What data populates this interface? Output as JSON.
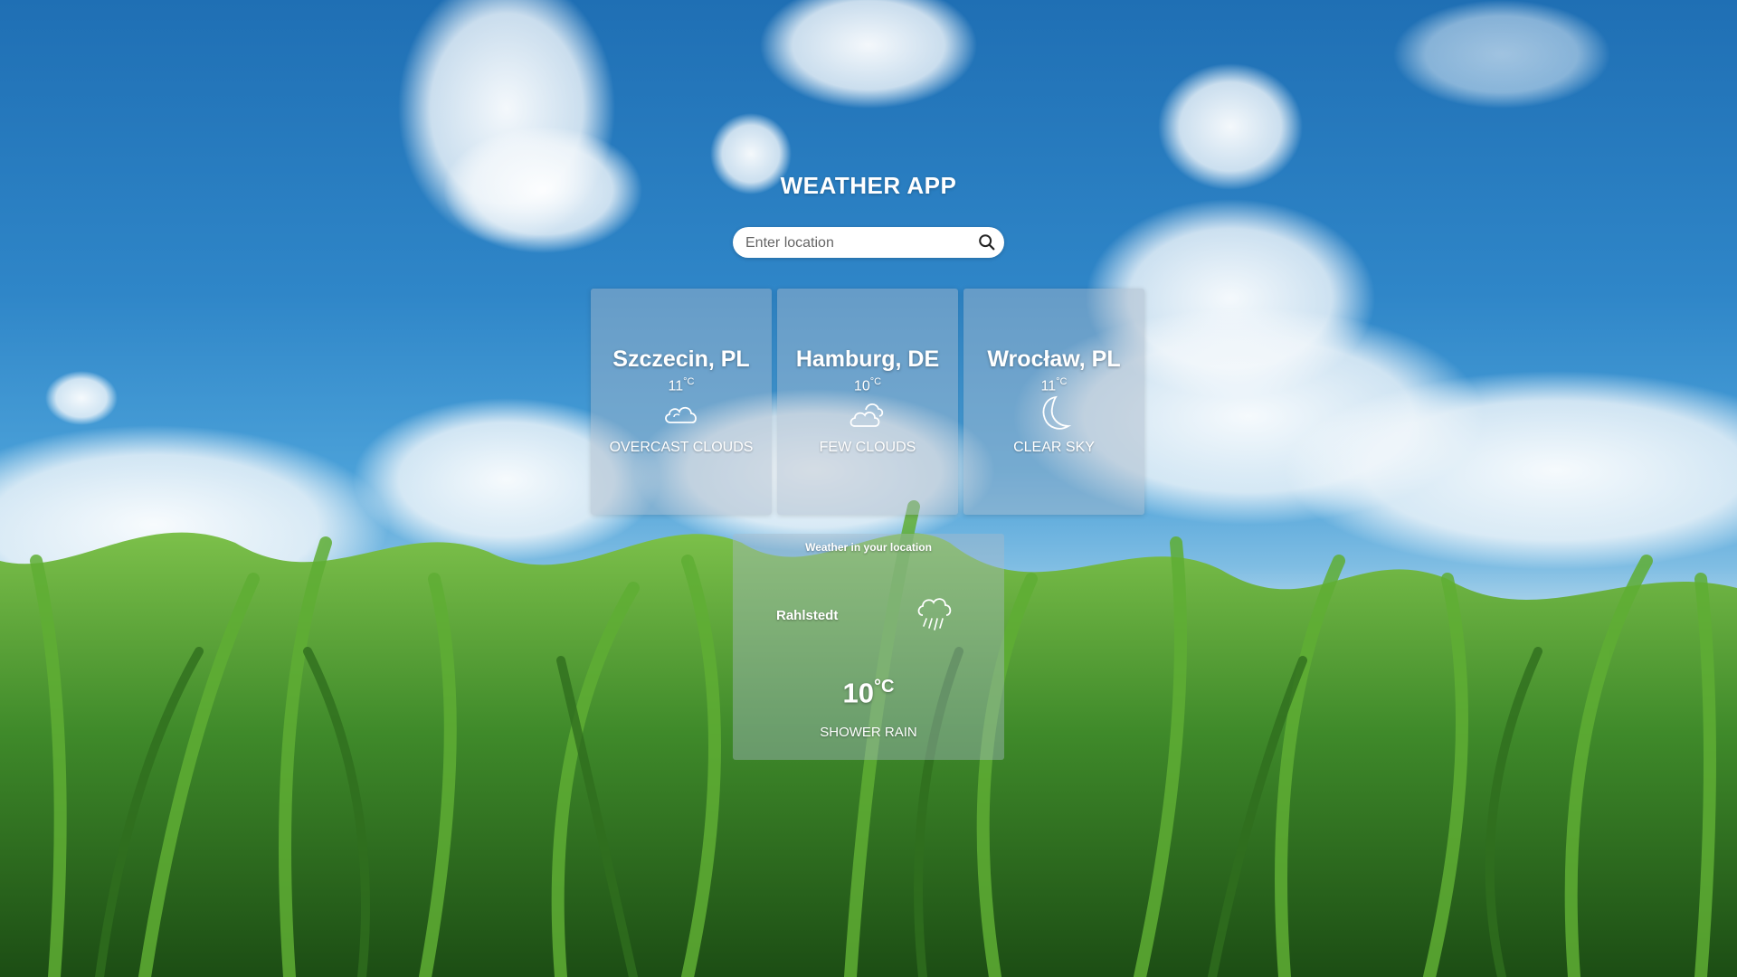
{
  "app": {
    "title": "WEATHER APP"
  },
  "search": {
    "placeholder": "Enter location",
    "value": "",
    "icon": "search-icon"
  },
  "cards": [
    {
      "city": "Szczecin, PL",
      "temp": "11",
      "unit": "°C",
      "icon": "overcast-clouds-icon",
      "description": "OVERCAST CLOUDS"
    },
    {
      "city": "Hamburg, DE",
      "temp": "10",
      "unit": "°C",
      "icon": "few-clouds-icon",
      "description": "FEW CLOUDS"
    },
    {
      "city": "Wrocław, PL",
      "temp": "11",
      "unit": "°C",
      "icon": "moon-icon",
      "description": "CLEAR SKY"
    }
  ],
  "local": {
    "heading": "Weather in your location",
    "place": "Rahlstedt",
    "temp": "10",
    "unit": "°C",
    "icon": "shower-rain-icon",
    "description": "SHOWER RAIN"
  },
  "colors": {
    "sky": "#2f86c8",
    "panel": "#aab9c8",
    "text": "#ffffff",
    "grass": "#3f8a2a"
  }
}
